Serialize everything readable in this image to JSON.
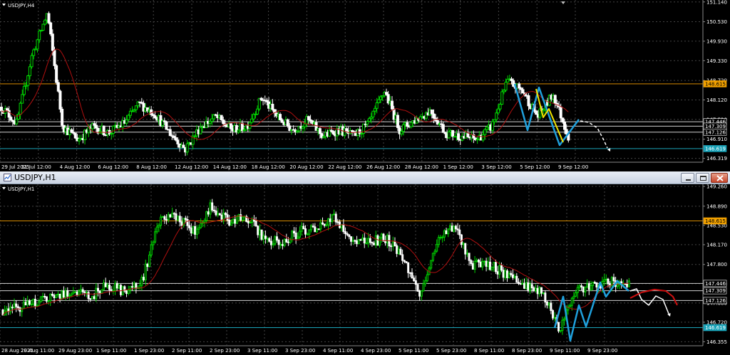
{
  "colors": {
    "bull": "#00d400",
    "bear": "#ffffff",
    "ma": "#b01010",
    "orange_line": "#d58a00",
    "cyan_line": "#1aa3b8",
    "wave_blue": "#1fa0dc",
    "wave_yellow": "#f2e600",
    "proj_white": "#ffffff",
    "proj_red": "#d01010",
    "grid": "#444444",
    "badge_orange": "#f0a000",
    "badge_cyan": "#1aa3b8"
  },
  "top": {
    "symbol": "USDJPY,H4",
    "price_min": 146.2,
    "price_max": 151.2,
    "price_ticks": [
      "151.140",
      "150.530",
      "149.930",
      "149.330",
      "148.720",
      "148.120",
      "147.520",
      "146.910",
      "146.319"
    ],
    "price_badges": [
      {
        "text": "148.615",
        "price": 148.615,
        "kind": "orange"
      },
      {
        "text": "147.446",
        "price": 147.446,
        "kind": "white"
      },
      {
        "text": "147.309",
        "price": 147.309,
        "kind": "white"
      },
      {
        "text": "147.126",
        "price": 147.126,
        "kind": "white"
      },
      {
        "text": "146.619",
        "price": 146.619,
        "kind": "cyan"
      }
    ],
    "time_labels": [
      "29 Jul 2025",
      "31 Jul 12:00",
      "4 Aug 12:00",
      "6 Aug 12:00",
      "8 Aug 12:00",
      "12 Aug 12:00",
      "14 Aug 12:00",
      "18 Aug 12:00",
      "20 Aug 12:00",
      "22 Aug 12:00",
      "26 Aug 12:00",
      "28 Aug 12:00",
      "1 Sep 12:00",
      "3 Sep 12:00",
      "5 Sep 12:00",
      "9 Sep 12:00"
    ]
  },
  "bottom": {
    "symbol": "USDJPY,H1",
    "window_title": "USDJPY,H1",
    "price_min": 146.28,
    "price_max": 149.3,
    "price_ticks": [
      "149.260",
      "148.890",
      "148.530",
      "148.170",
      "147.800",
      "147.440",
      "147.080",
      "146.720",
      "146.355"
    ],
    "price_badges": [
      {
        "text": "148.615",
        "price": 148.615,
        "kind": "orange"
      },
      {
        "text": "147.446",
        "price": 147.446,
        "kind": "white"
      },
      {
        "text": "147.309",
        "price": 147.309,
        "kind": "white"
      },
      {
        "text": "147.126",
        "price": 147.126,
        "kind": "white"
      },
      {
        "text": "146.619",
        "price": 146.619,
        "kind": "cyan"
      }
    ],
    "time_labels": [
      "28 Aug 2025",
      "29 Aug 11:00",
      "29 Aug 23:00",
      "1 Sep 11:00",
      "1 Sep 23:00",
      "2 Sep 11:00",
      "2 Sep 23:00",
      "3 Sep 11:00",
      "3 Sep 23:00",
      "4 Sep 11:00",
      "4 Sep 23:00",
      "5 Sep 11:00",
      "5 Sep 23:00",
      "8 Sep 11:00",
      "8 Sep 23:00",
      "9 Sep 11:00",
      "9 Sep 23:00"
    ]
  },
  "chart_data": [
    {
      "type": "line",
      "title": "USDJPY,H4",
      "x": [
        "29 Jul",
        "31 Jul",
        "4 Aug",
        "6 Aug",
        "8 Aug",
        "12 Aug",
        "14 Aug",
        "18 Aug",
        "20 Aug",
        "22 Aug",
        "26 Aug",
        "28 Aug",
        "1 Sep",
        "3 Sep",
        "5 Sep",
        "9 Sep"
      ],
      "series": [
        {
          "values": [
            147.9,
            150.5,
            147.2,
            146.9,
            147.5,
            148.1,
            146.7,
            147.4,
            147.0,
            148.4,
            147.6,
            147.0,
            147.1,
            148.6,
            147.0,
            146.7
          ]
        }
      ],
      "levels": [
        148.615,
        147.446,
        147.309,
        147.126,
        146.619
      ],
      "ylim": [
        146.2,
        151.2
      ]
    },
    {
      "type": "line",
      "title": "USDJPY,H1",
      "x": [
        "28 Aug",
        "29 Aug 11:00",
        "29 Aug 23:00",
        "1 Sep 11:00",
        "1 Sep 23:00",
        "2 Sep 11:00",
        "2 Sep 23:00",
        "3 Sep 11:00",
        "3 Sep 23:00",
        "4 Sep 11:00",
        "4 Sep 23:00",
        "5 Sep 11:00",
        "5 Sep 23:00",
        "8 Sep 11:00",
        "8 Sep 23:00",
        "9 Sep 11:00",
        "9 Sep 23:00"
      ],
      "series": [
        {
          "values": [
            146.9,
            147.0,
            147.1,
            147.3,
            147.2,
            148.6,
            148.8,
            148.7,
            148.2,
            148.3,
            148.5,
            148.2,
            148.3,
            147.6,
            147.4,
            146.5,
            147.4
          ]
        }
      ],
      "levels": [
        148.615,
        147.446,
        147.309,
        147.126,
        146.619
      ],
      "ylim": [
        146.28,
        149.3
      ]
    }
  ]
}
